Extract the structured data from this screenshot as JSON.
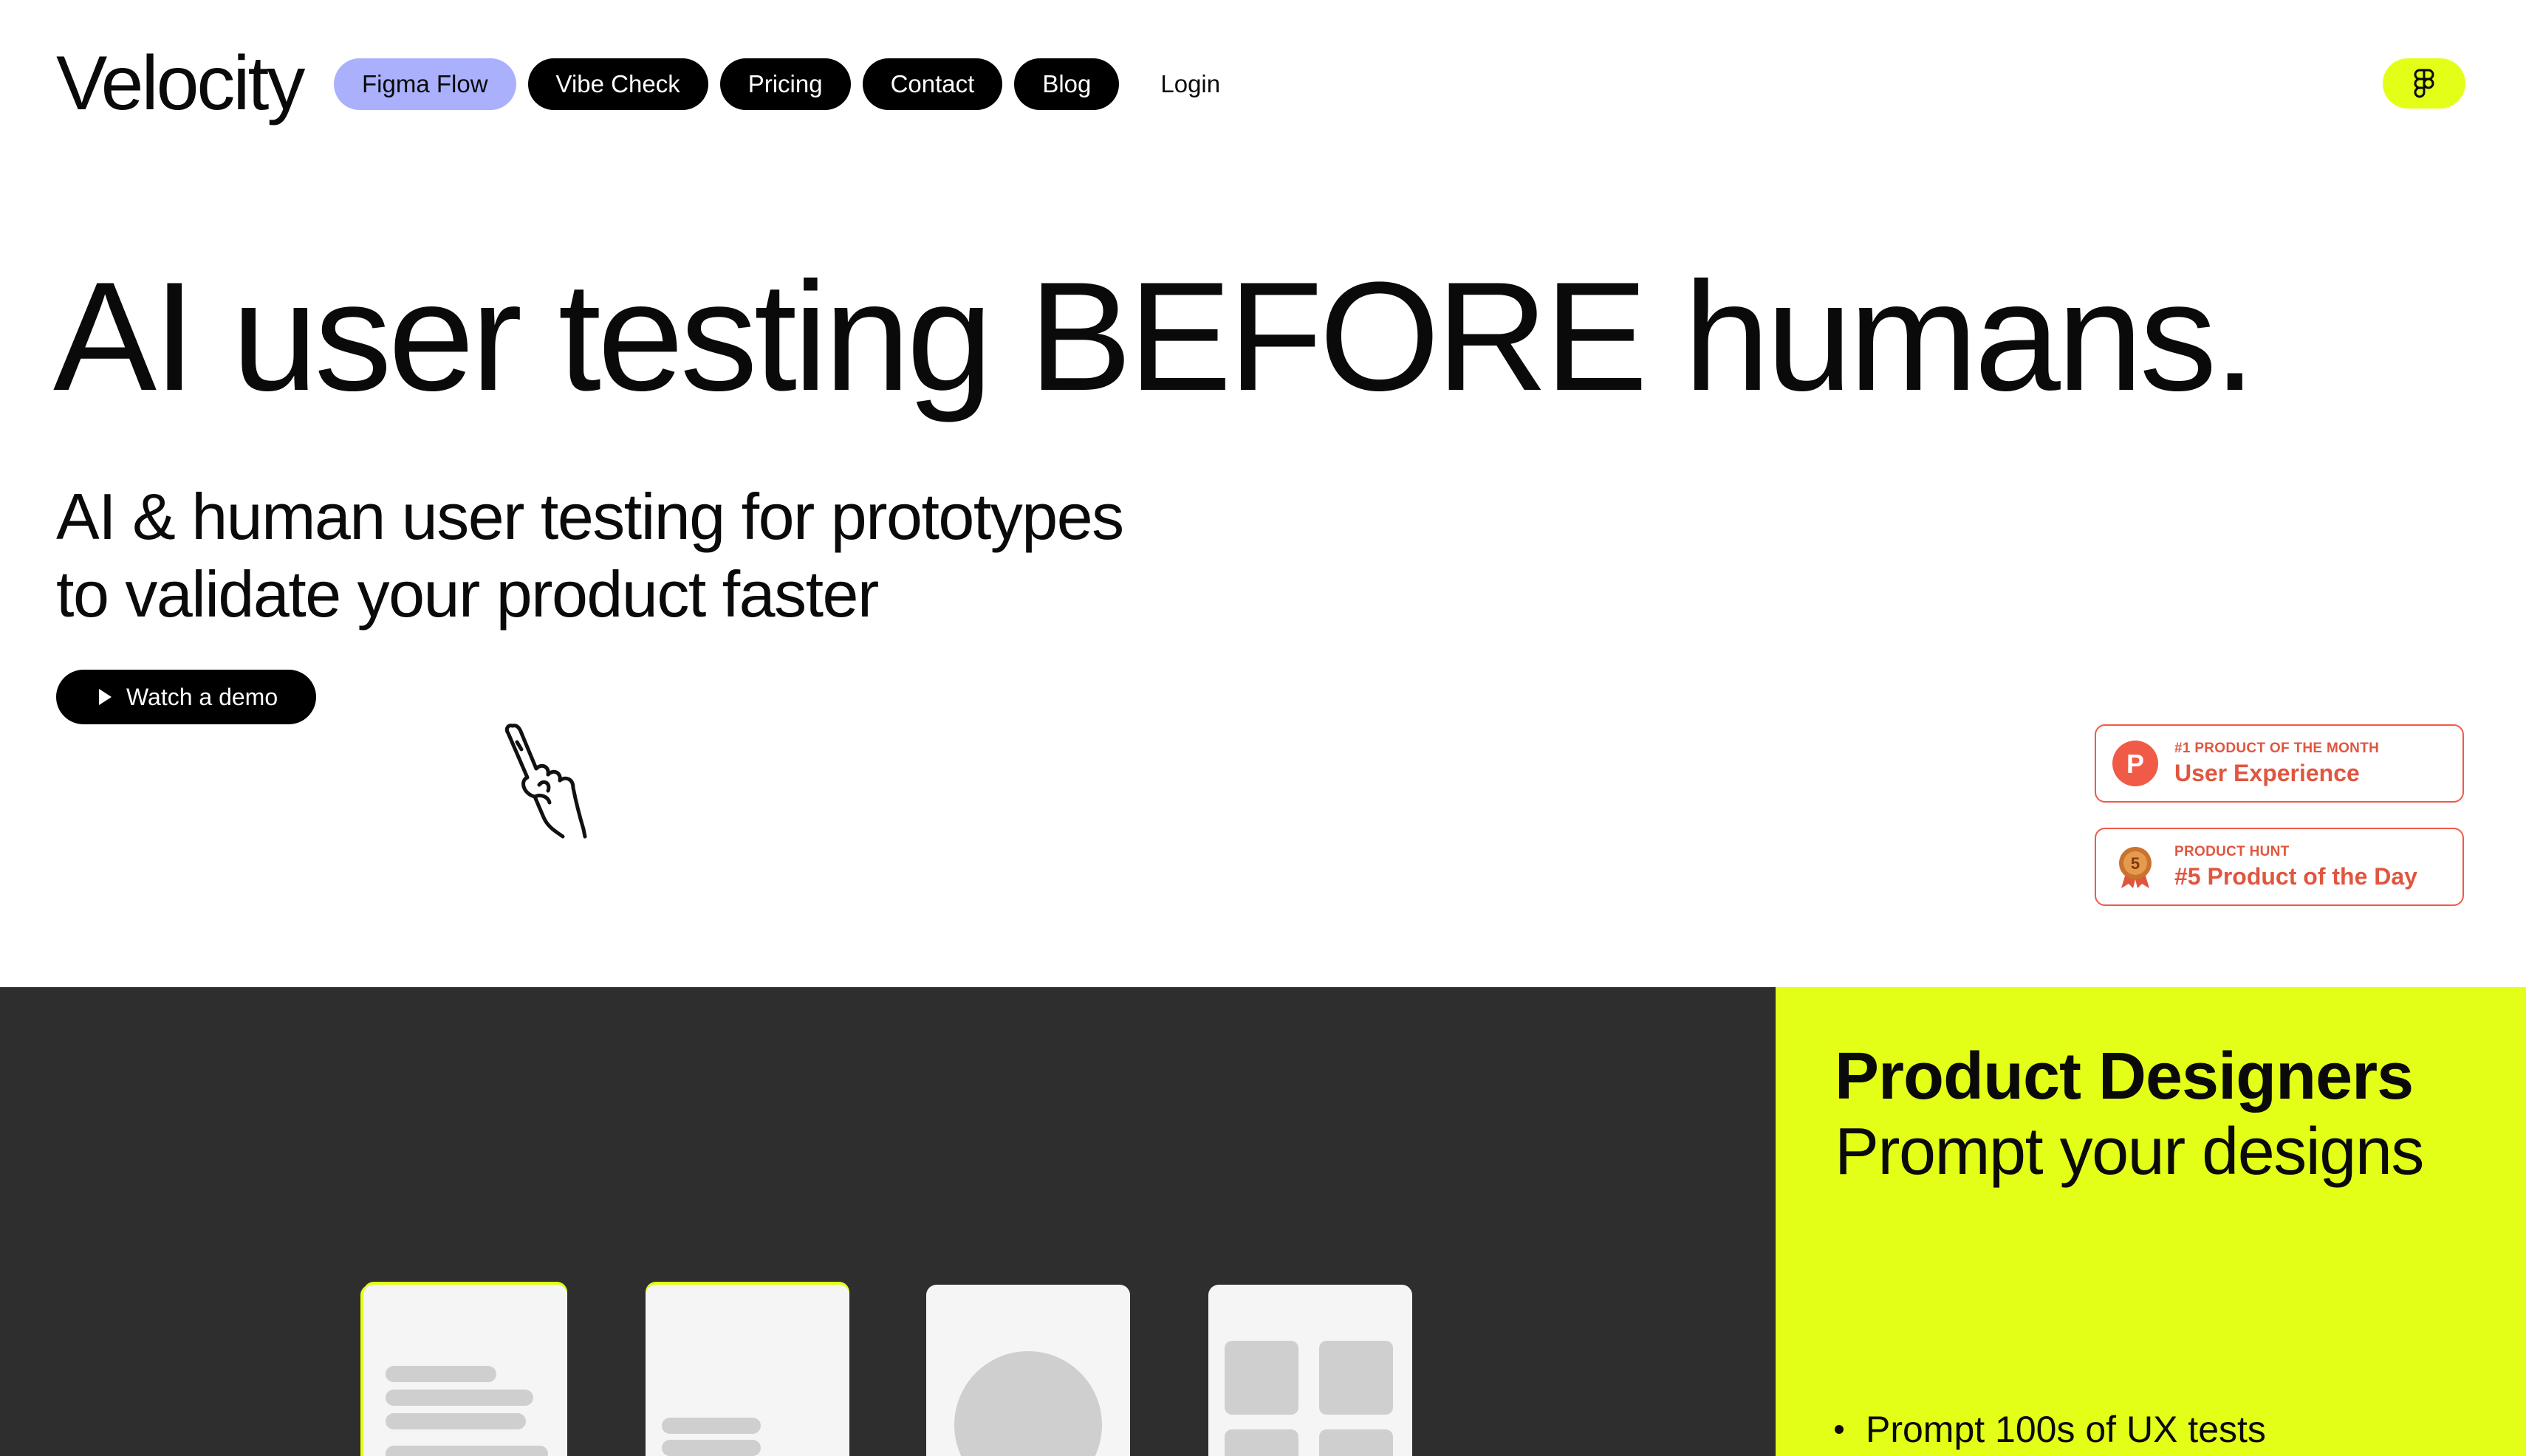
{
  "header": {
    "logo": "Velocity",
    "nav": [
      {
        "label": "Figma Flow",
        "active": true
      },
      {
        "label": "Vibe Check",
        "active": false
      },
      {
        "label": "Pricing",
        "active": false
      },
      {
        "label": "Contact",
        "active": false
      },
      {
        "label": "Blog",
        "active": false
      }
    ],
    "login_label": "Login",
    "figma_icon": "figma-icon",
    "accent": "#e3ff17",
    "active_nav_color": "#aab0fb"
  },
  "hero": {
    "title": "AI user testing BEFORE humans.",
    "subtitle_line1": "AI & human user testing for prototypes",
    "subtitle_line2": "to validate your product faster",
    "demo_button": "Watch a demo",
    "demo_icon": "play-icon",
    "pointer_icon": "pointing-hand-icon"
  },
  "badges": [
    {
      "kicker": "#1 PRODUCT OF THE MONTH",
      "main": "User Experience",
      "icon": "product-hunt-icon",
      "icon_letter": "P"
    },
    {
      "kicker": "PRODUCT HUNT",
      "main": "#5 Product of the Day",
      "icon": "medal-icon",
      "icon_letter": "5"
    }
  ],
  "badge_color": "#e0563f",
  "feature": {
    "title": "Product Designers",
    "subtitle": "Prompt your designs",
    "bullets": [
      "Prompt 100s of UX tests"
    ]
  }
}
